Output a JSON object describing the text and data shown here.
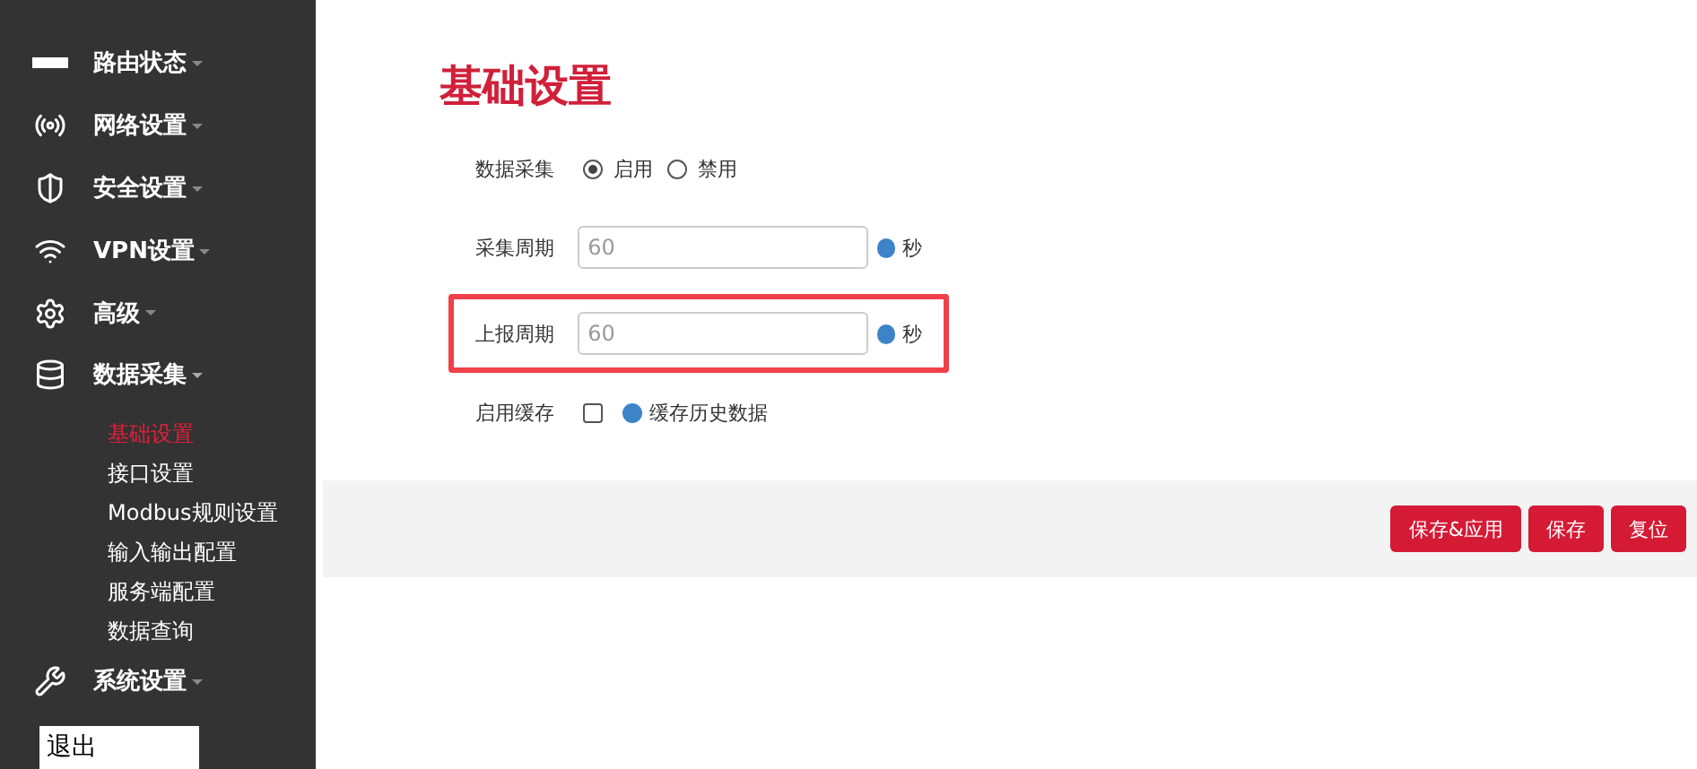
{
  "sidebar": {
    "items": [
      {
        "label": "路由状态",
        "expanded": false
      },
      {
        "label": "网络设置",
        "expanded": false
      },
      {
        "label": "安全设置",
        "expanded": false
      },
      {
        "label": "VPN设置",
        "expanded": false
      },
      {
        "label": "高级",
        "expanded": false
      },
      {
        "label": "数据采集",
        "expanded": true,
        "children": [
          {
            "label": "基础设置",
            "selected": true
          },
          {
            "label": "接口设置",
            "selected": false
          },
          {
            "label": "Modbus规则设置",
            "selected": false
          },
          {
            "label": "输入输出配置",
            "selected": false
          },
          {
            "label": "服务端配置",
            "selected": false
          },
          {
            "label": "数据查询",
            "selected": false
          }
        ]
      },
      {
        "label": "系统设置",
        "expanded": false
      }
    ],
    "logout": "退出"
  },
  "title": "基础设置",
  "form": [
    {
      "kind": "radio",
      "label": "数据采集",
      "highlighted": false,
      "options": [
        {
          "label": "启用",
          "selected": true
        },
        {
          "label": "禁用",
          "selected": false
        }
      ]
    },
    {
      "kind": "input",
      "label": "采集周期",
      "highlighted": false,
      "value": "60",
      "unit": "秒"
    },
    {
      "kind": "input",
      "label": "上报周期",
      "highlighted": true,
      "value": "60",
      "unit": "秒"
    },
    {
      "kind": "checkbox",
      "label": "启用缓存",
      "highlighted": false,
      "checked": false,
      "hint": "缓存历史数据"
    }
  ],
  "buttons": [
    "保存&应用",
    "保存",
    "复位"
  ]
}
